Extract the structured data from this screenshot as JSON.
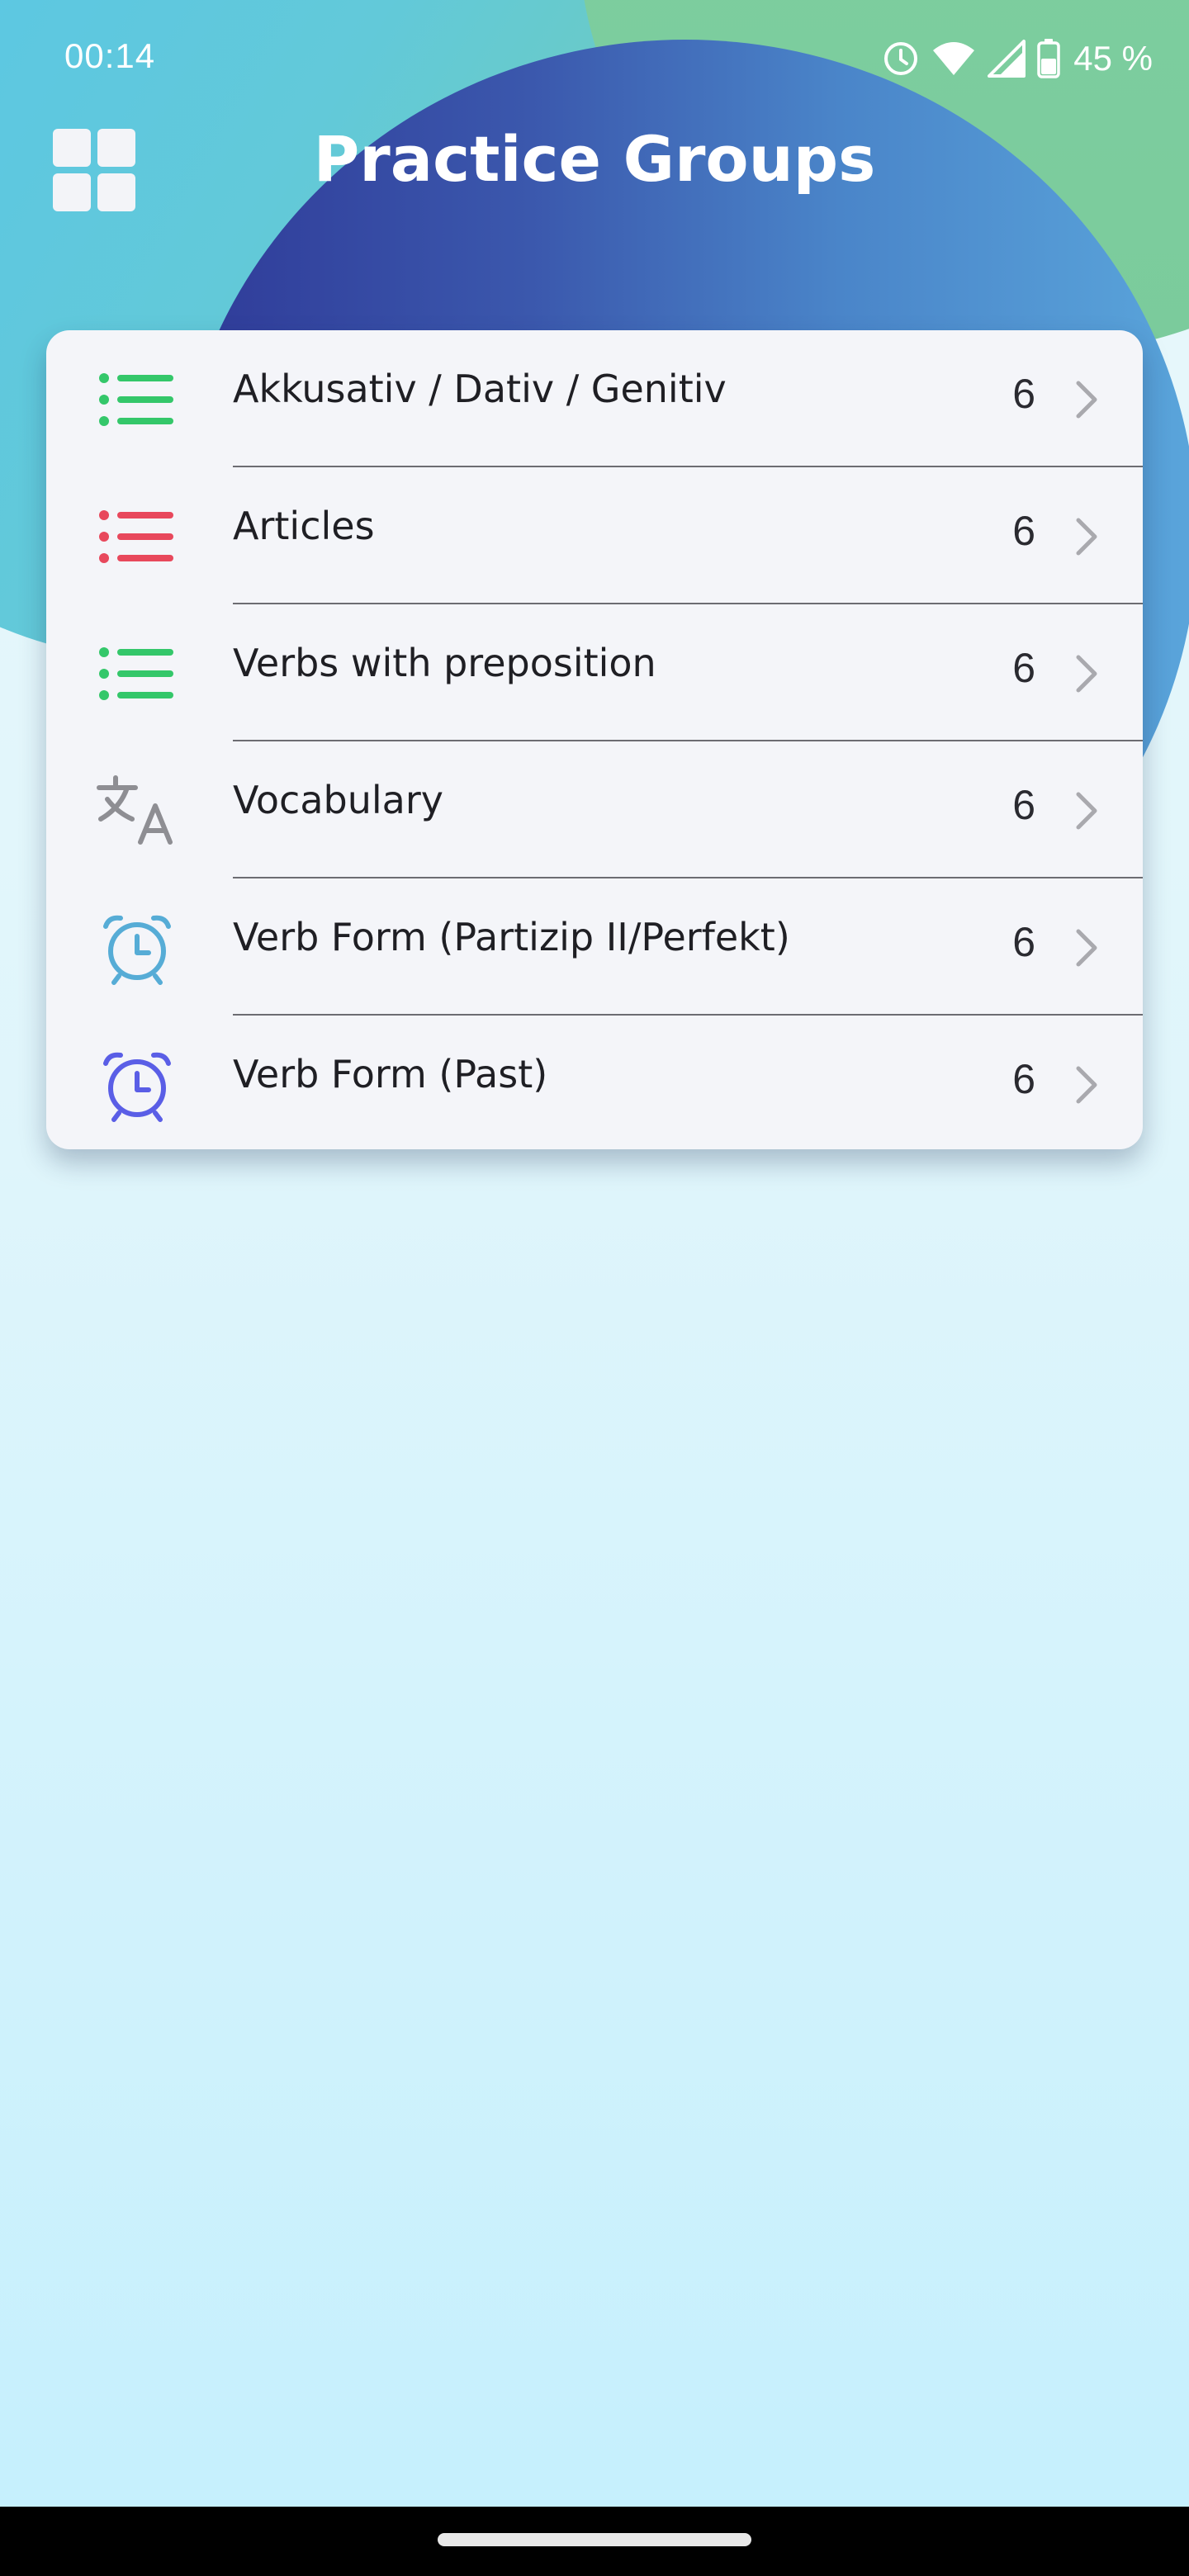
{
  "status_bar": {
    "time": "00:14",
    "battery": "45 %",
    "icons": [
      "alarm-icon",
      "wifi-icon",
      "cellular-signal-icon",
      "battery-icon"
    ]
  },
  "header": {
    "title": "Practice Groups",
    "menu_icon": "grid-menu-icon"
  },
  "groups": [
    {
      "label": "Akkusativ / Dativ / Genitiv",
      "count": "6",
      "icon": "list-icon",
      "icon_color": "#34c76a"
    },
    {
      "label": "Articles",
      "count": "6",
      "icon": "list-icon",
      "icon_color": "#e8485c"
    },
    {
      "label": "Verbs with preposition",
      "count": "6",
      "icon": "list-icon",
      "icon_color": "#34c76a"
    },
    {
      "label": "Vocabulary",
      "count": "6",
      "icon": "translate-icon",
      "icon_color": "#8e8e93"
    },
    {
      "label": "Verb Form (Partizip II/Perfekt)",
      "count": "6",
      "icon": "alarm-clock-icon",
      "icon_color": "#56acd6"
    },
    {
      "label": "Verb Form (Past)",
      "count": "6",
      "icon": "alarm-clock-icon",
      "icon_color": "#5a5ee6"
    }
  ],
  "colors": {
    "chevron": "#a9a9ae",
    "card_background": "#f4f5f9"
  }
}
